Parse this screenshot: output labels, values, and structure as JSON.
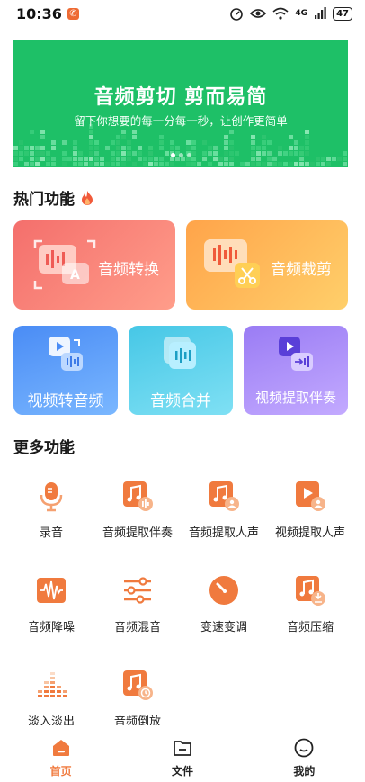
{
  "status_bar": {
    "time": "10:36",
    "notification_badge": "✆",
    "battery": "47",
    "network": "4G"
  },
  "banner": {
    "title": "音频剪切 剪而易简",
    "subtitle": "留下你想要的每一分每一秒，让创作更简单",
    "color": "#1ec067",
    "page_indicator": {
      "count": 3,
      "active": 0
    }
  },
  "hot_section": {
    "title": "热门功能"
  },
  "hot_cards": {
    "audio_convert": "音频转换",
    "audio_trim": "音频裁剪",
    "video_to_audio": "视频转音频",
    "audio_merge": "音频合并",
    "video_extract_accompaniment": "视频提取伴奏"
  },
  "more_section": {
    "title": "更多功能"
  },
  "more_items": [
    {
      "label": "录音",
      "icon": "microphone-icon"
    },
    {
      "label": "音频提取伴奏",
      "icon": "music-file-icon"
    },
    {
      "label": "音频提取人声",
      "icon": "music-file-person-icon"
    },
    {
      "label": "视频提取人声",
      "icon": "video-file-person-icon"
    },
    {
      "label": "音频降噪",
      "icon": "waveform-icon"
    },
    {
      "label": "音频混音",
      "icon": "sliders-icon"
    },
    {
      "label": "变速变调",
      "icon": "speedometer-icon"
    },
    {
      "label": "音频压缩",
      "icon": "music-compress-icon"
    },
    {
      "label": "淡入淡出",
      "icon": "equalizer-icon"
    },
    {
      "label": "音频倒放",
      "icon": "music-reverse-icon"
    }
  ],
  "bottom_nav": [
    {
      "label": "首页",
      "active": true
    },
    {
      "label": "文件",
      "active": false
    },
    {
      "label": "我的",
      "active": false
    }
  ],
  "colors": {
    "accent": "#f07a3e",
    "banner": "#1ec067"
  }
}
